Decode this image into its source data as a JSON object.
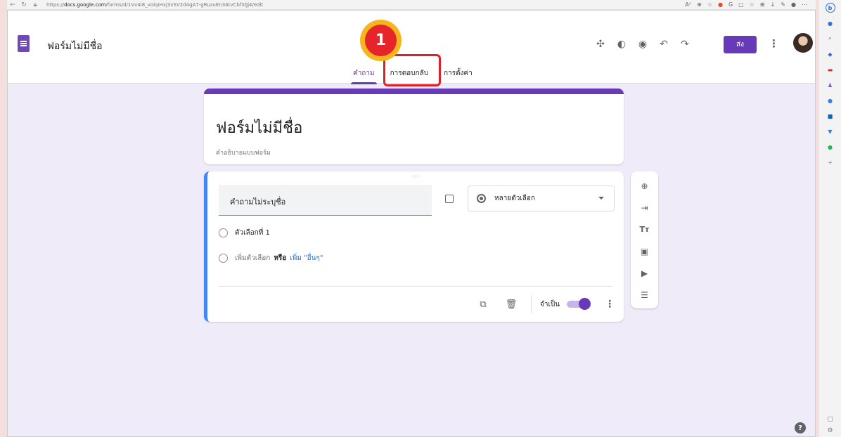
{
  "browser": {
    "url_prefix": "https://",
    "url_host": "docs.google.com",
    "url_path": "/forms/d/1Vv4i8_vokpHxj3vSV2d4gA7-gRuzuEn34tvCbfXlJj4/edit",
    "zoom_label": "Aᴬ"
  },
  "app": {
    "title": "ฟอร์มไม่มีชื่อ",
    "send_label": "ส่ง",
    "tabs": [
      {
        "label": "คำถาม",
        "active": true
      },
      {
        "label": "การตอบกลับ",
        "active": false
      },
      {
        "label": "การตั้งค่า",
        "active": false
      }
    ]
  },
  "annotation": {
    "step_number": "1",
    "highlight_color": "#e01f26",
    "badge_color": "#f7b51d"
  },
  "form": {
    "title": "ฟอร์มไม่มีชื่อ",
    "description_placeholder": "คำอธิบายแบบฟอร์ม"
  },
  "question": {
    "title": "คำถามไม่ระบุชื่อ",
    "type_label": "หลายตัวเลือก",
    "option1": "ตัวเลือกที่ 1",
    "add_option": "เพิ่มตัวเลือก",
    "or_label": "หรือ",
    "add_other": "เพิ่ม \"อื่นๆ\"",
    "required_label": "จำเป็น",
    "required_on": true
  },
  "colors": {
    "accent": "#673ab7",
    "question_bar": "#4285f4",
    "background": "#f0ebf8"
  }
}
